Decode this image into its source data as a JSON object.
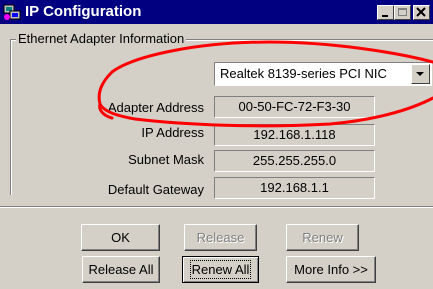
{
  "window": {
    "title": "IP Configuration",
    "icon": "network-config-icon",
    "controls": [
      "minimize-icon",
      "maximize-icon",
      "close-icon"
    ]
  },
  "group": {
    "label": "Ethernet Adapter Information"
  },
  "adapter_select": {
    "value": "Realtek 8139-series PCI NIC",
    "icon": "dropdown-arrow-icon"
  },
  "fields": [
    {
      "label": "Adapter Address",
      "value": "00-50-FC-72-F3-30"
    },
    {
      "label": "IP Address",
      "value": "192.168.1.118"
    },
    {
      "label": "Subnet Mask",
      "value": "255.255.255.0"
    },
    {
      "label": "Default Gateway",
      "value": "192.168.1.1"
    }
  ],
  "buttons": {
    "ok": "OK",
    "release": "Release",
    "renew": "Renew",
    "release_all": "Release All",
    "renew_all": "Renew All",
    "more_info": "More Info >>"
  },
  "colors": {
    "titlebar": "#000080",
    "face": "#d4d0c8",
    "annotation": "#ff0000"
  }
}
